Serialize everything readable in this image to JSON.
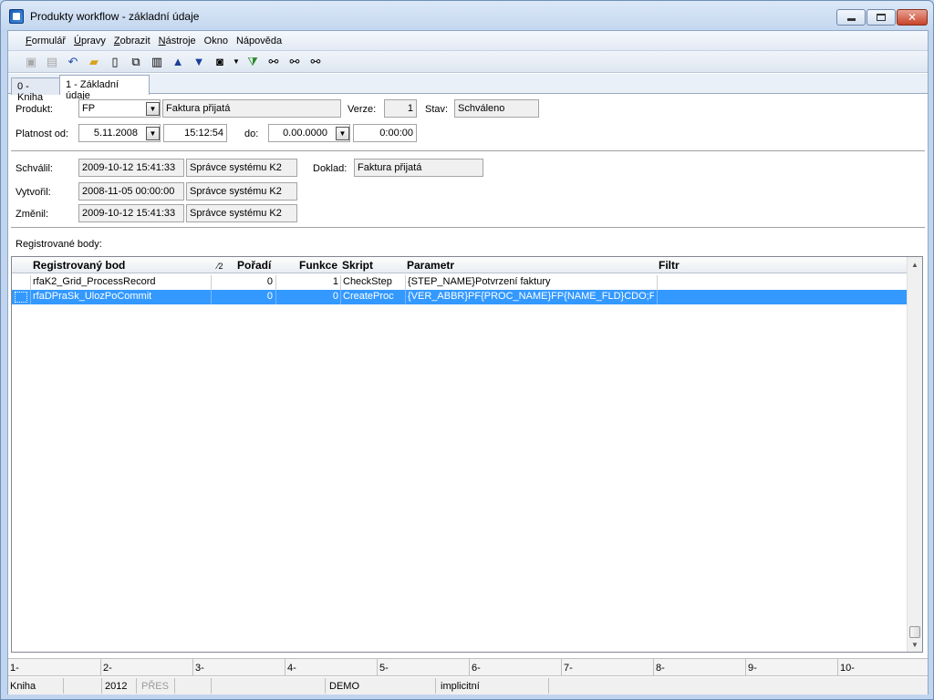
{
  "window": {
    "title": "Produkty workflow - základní údaje"
  },
  "menu": [
    {
      "label": "Formulář",
      "u": "F"
    },
    {
      "label": "Úpravy",
      "u": "Ú"
    },
    {
      "label": "Zobrazit",
      "u": "Z"
    },
    {
      "label": "Nástroje",
      "u": "N"
    },
    {
      "label": "Okno",
      "u": ""
    },
    {
      "label": "Nápověda",
      "u": ""
    }
  ],
  "tabs": [
    {
      "label": "0 - Kniha"
    },
    {
      "label": "1 - Základní údaje"
    }
  ],
  "form": {
    "produkt_label": "Produkt:",
    "produkt_code": "FP",
    "produkt_name": "Faktura přijatá",
    "verze_label": "Verze:",
    "verze_value": "1",
    "stav_label": "Stav:",
    "stav_value": "Schváleno",
    "platnost_label": "Platnost od:",
    "platnost_date": "5.11.2008",
    "platnost_time": "15:12:54",
    "do_label": "do:",
    "do_date": "0.00.0000",
    "do_time": "0:00:00",
    "schvalil_label": "Schválil:",
    "schvalil_date": "2009-10-12 15:41:33",
    "schvalil_user": "Správce systému K2",
    "doklad_label": "Doklad:",
    "doklad_value": "Faktura přijatá",
    "vytvoril_label": "Vytvořil:",
    "vytvoril_date": "2008-11-05 00:00:00",
    "vytvoril_user": "Správce systému K2",
    "zmenil_label": "Změnil:",
    "zmenil_date": "2009-10-12 15:41:33",
    "zmenil_user": "Správce systému K2",
    "registered_label": "Registrované body:"
  },
  "grid": {
    "columns": [
      "Registrovaný bod",
      "⁄2",
      "Pořadí",
      "Funkce",
      "Skript",
      "Parametr",
      "Filtr"
    ],
    "rows": [
      {
        "bod": "rfaK2_Grid_ProcessRecord",
        "poradi": "0",
        "funkce": "1",
        "skript": "CheckStep",
        "parametr": "{STEP_NAME}Potvrzení faktury",
        "filtr": ""
      },
      {
        "bod": "rfaDPraSk_UlozPoCommit",
        "poradi": "0",
        "funkce": "0",
        "skript": "CreateProc",
        "parametr": "{VER_ABBR}PF{PROC_NAME}FP{NAME_FLD}CDO;FIR",
        "filtr": ""
      }
    ],
    "selected_row": 1
  },
  "fkeys": [
    "1-",
    "2-",
    "3-",
    "4-",
    "5-",
    "6-",
    "7-",
    "8-",
    "9-",
    "10-"
  ],
  "status": {
    "kniha": "Kniha",
    "year": "2012",
    "pres": "PŘES",
    "demo": "DEMO",
    "mode": "implicitní"
  },
  "colors": {
    "selection": "#3399ff",
    "titlebar": "#c4d7ef"
  }
}
